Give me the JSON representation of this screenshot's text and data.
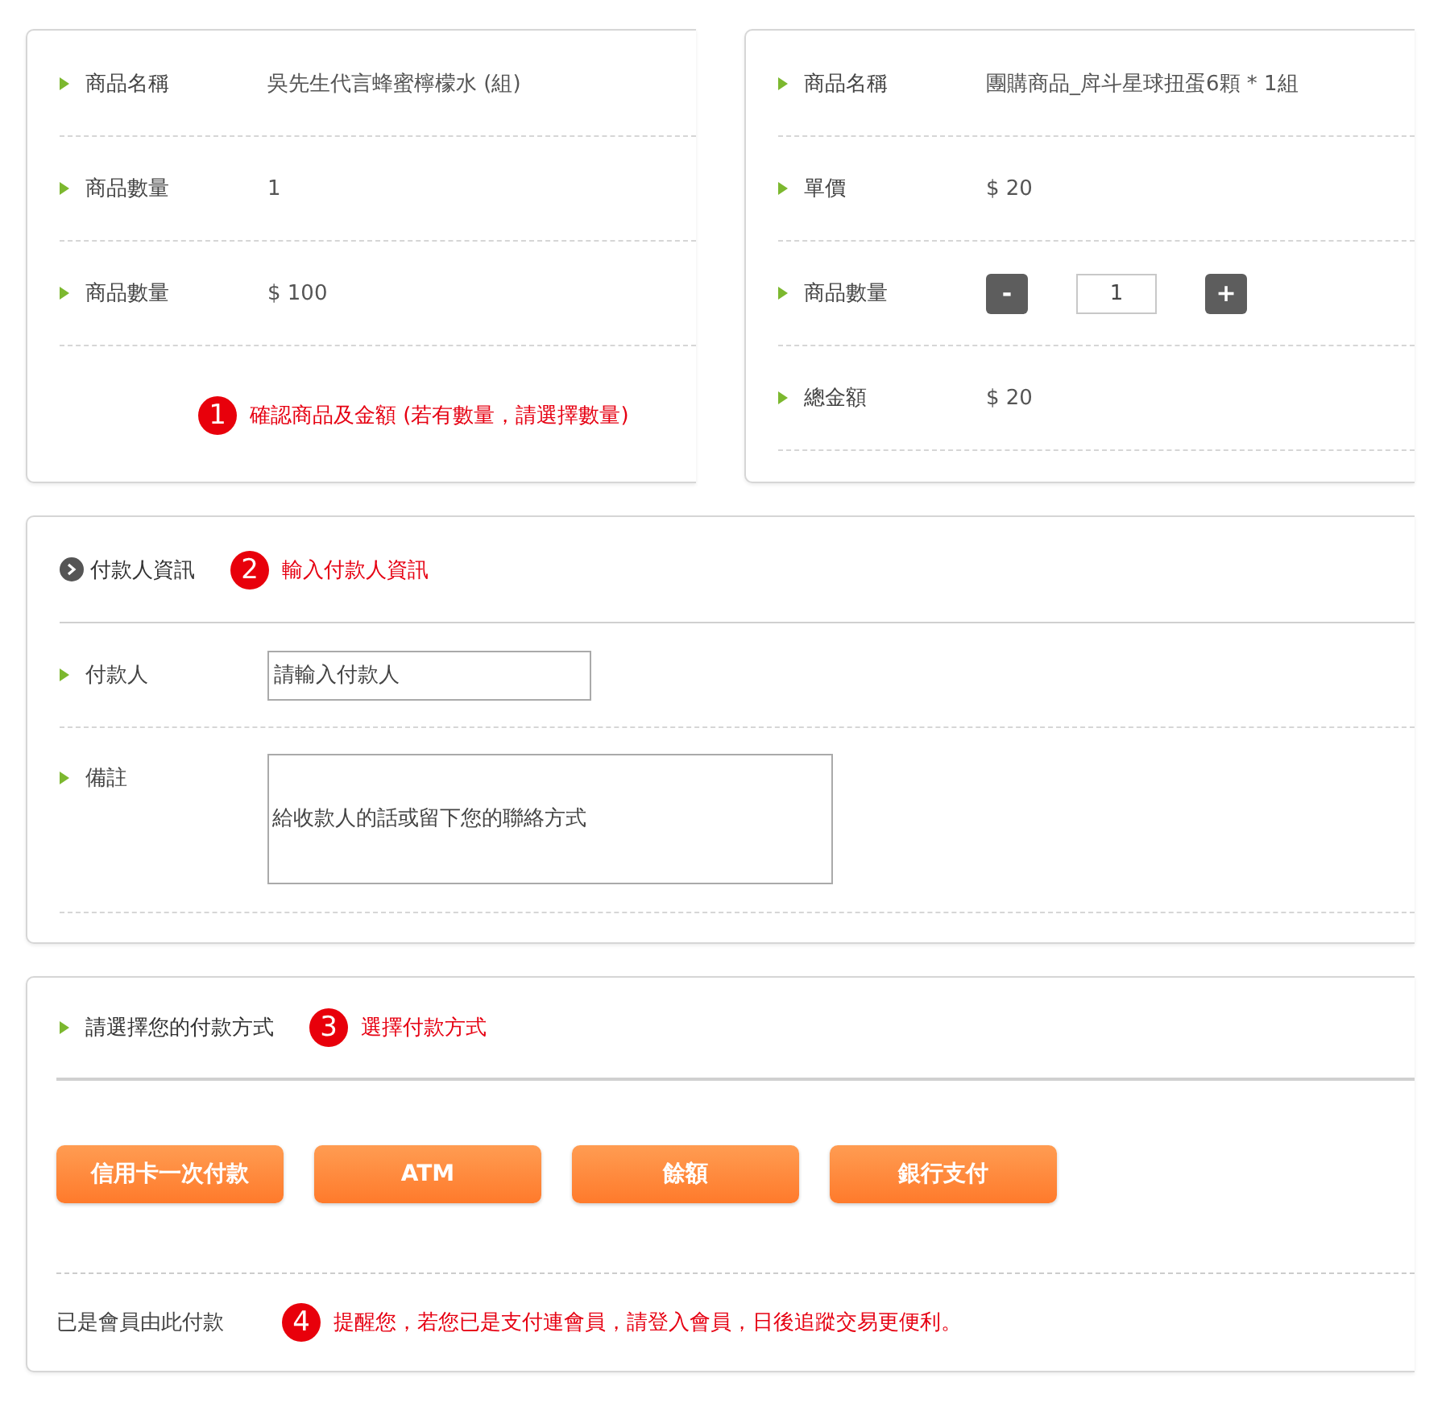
{
  "product_card": {
    "rows": [
      {
        "label": "商品名稱",
        "value": "吳先生代言蜂蜜檸檬水 (組)"
      },
      {
        "label": "商品數量",
        "value": "1"
      },
      {
        "label": "商品數量",
        "value": "$ 100"
      }
    ],
    "note": {
      "number": "1",
      "text": "確認商品及金額 (若有數量，請選擇數量)"
    }
  },
  "order_card": {
    "rows": [
      {
        "kind": "text",
        "label": "商品名稱",
        "value": "團購商品_戽斗星球扭蛋6顆 * 1組"
      },
      {
        "kind": "text",
        "label": "單價",
        "value": "$ 20"
      },
      {
        "kind": "stepper",
        "label": "商品數量",
        "minus": "-",
        "quantity": "1",
        "plus": "+"
      },
      {
        "kind": "text",
        "label": "總金額",
        "value": "$ 20"
      }
    ]
  },
  "payer_card": {
    "title": "付款人資訊",
    "note": {
      "number": "2",
      "text": "輸入付款人資訊"
    },
    "fields": [
      {
        "kind": "input",
        "label": "付款人",
        "placeholder": "請輸入付款人"
      },
      {
        "kind": "textarea",
        "label": "備註",
        "placeholder": "給收款人的話或留下您的聯絡方式"
      }
    ]
  },
  "payment_card": {
    "title": "請選擇您的付款方式",
    "note": {
      "number": "3",
      "text": "選擇付款方式"
    },
    "methods": [
      "信用卡一次付款",
      "ATM",
      "餘額",
      "銀行支付"
    ],
    "member_link": "已是會員由此付款",
    "reminder": {
      "number": "4",
      "text": "提醒您，若您已是支付連會員，請登入會員，日後追蹤交易更便利。"
    }
  }
}
